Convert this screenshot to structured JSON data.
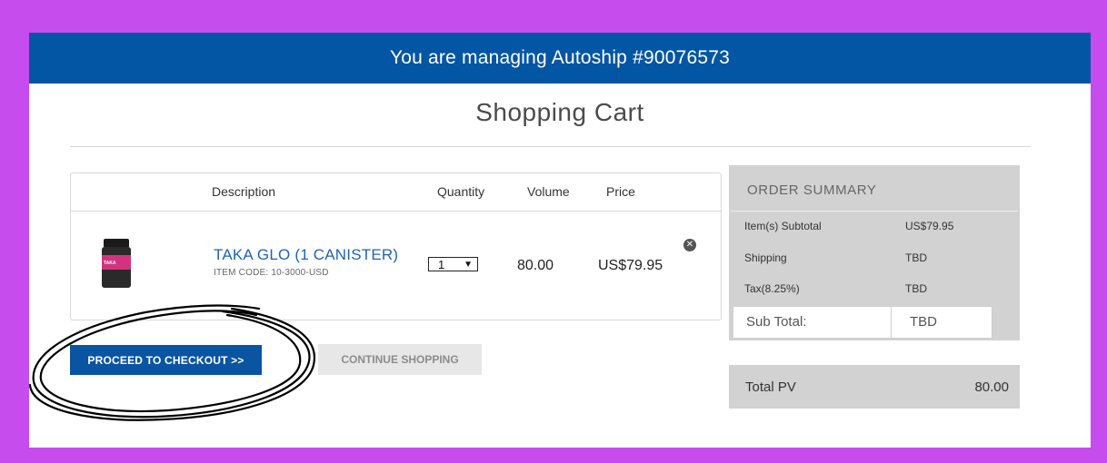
{
  "banner": {
    "text": "You are managing Autoship #90076573"
  },
  "page": {
    "title": "Shopping Cart"
  },
  "cart": {
    "columns": {
      "description": "Description",
      "quantity": "Quantity",
      "volume": "Volume",
      "price": "Price"
    },
    "items": [
      {
        "name": "TAKA GLO (1 CANISTER)",
        "item_code": "ITEM CODE: 10-3000-USD",
        "quantity": "1",
        "volume": "80.00",
        "price": "US$79.95",
        "image_label": "TAKA"
      }
    ]
  },
  "actions": {
    "checkout_label": "PROCEED TO CHECKOUT >>",
    "continue_label": "CONTINUE SHOPPING"
  },
  "summary": {
    "title": "ORDER SUMMARY",
    "rows": [
      {
        "label": "Item(s) Subtotal",
        "value": "US$79.95"
      },
      {
        "label": "Shipping",
        "value": "TBD"
      },
      {
        "label": "Tax(8.25%)",
        "value": "TBD"
      }
    ],
    "subtotal": {
      "label": "Sub Total:",
      "value": "TBD"
    }
  },
  "total_pv": {
    "label": "Total PV",
    "value": "80.00"
  },
  "colors": {
    "frame": "#c64cee",
    "banner": "#0356a3",
    "checkout_button": "#0a55a1",
    "link": "#1f63b3",
    "summary_bg": "#d2d2d2"
  },
  "icons": {
    "remove": "remove-circle-icon",
    "dropdown": "chevron-down-icon"
  }
}
